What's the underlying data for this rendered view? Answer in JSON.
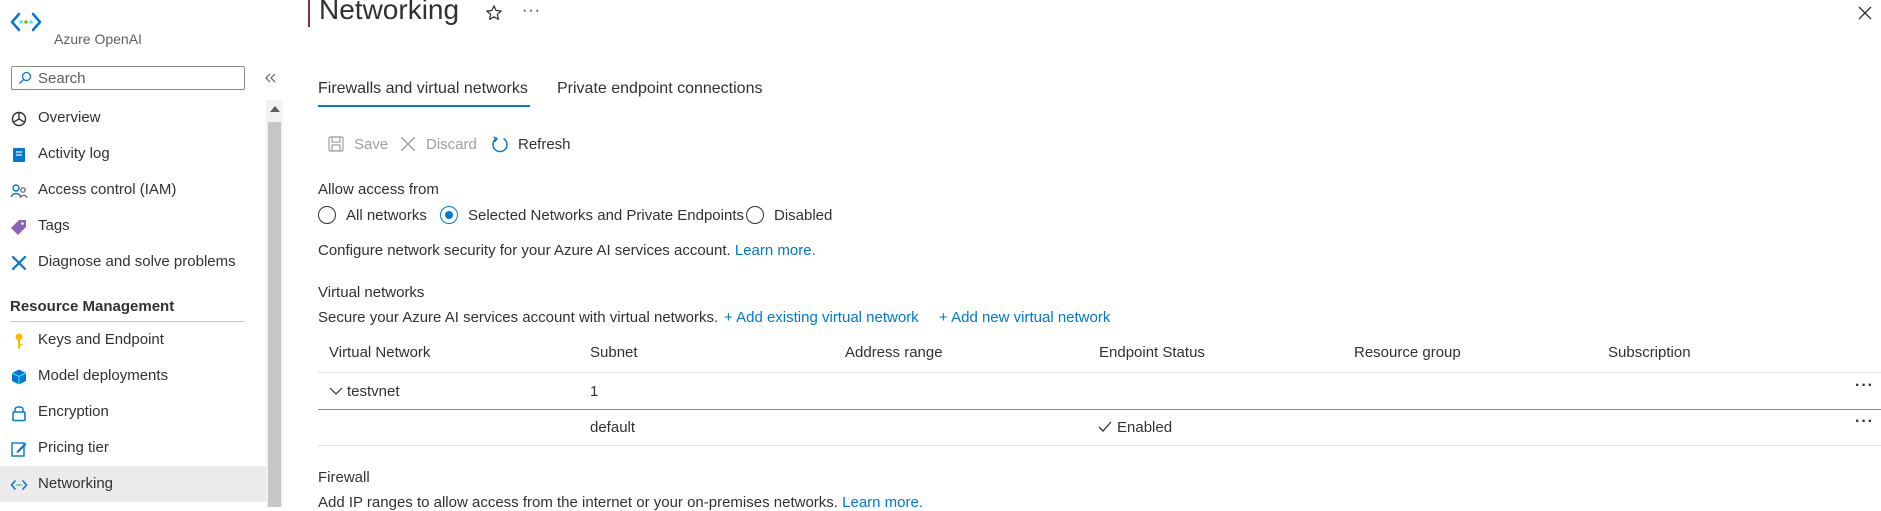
{
  "sidebar": {
    "brand_name": "Azure OpenAI",
    "search_placeholder": "Search",
    "items": [
      {
        "label": "Overview",
        "icon": "openai-icon"
      },
      {
        "label": "Activity log",
        "icon": "activity-log-icon"
      },
      {
        "label": "Access control (IAM)",
        "icon": "people-icon"
      },
      {
        "label": "Tags",
        "icon": "tag-icon"
      },
      {
        "label": "Diagnose and solve problems",
        "icon": "wrench-icon"
      }
    ],
    "section_title": "Resource Management",
    "section_items": [
      {
        "label": "Keys and Endpoint",
        "icon": "key-icon"
      },
      {
        "label": "Model deployments",
        "icon": "cube-icon"
      },
      {
        "label": "Encryption",
        "icon": "lock-icon"
      },
      {
        "label": "Pricing tier",
        "icon": "edit-icon"
      },
      {
        "label": "Networking",
        "icon": "networking-icon",
        "active": true
      }
    ]
  },
  "header": {
    "title": "Networking",
    "more": "···"
  },
  "tabs": [
    {
      "label": "Firewalls and virtual networks",
      "selected": true
    },
    {
      "label": "Private endpoint connections",
      "selected": false
    }
  ],
  "toolbar": {
    "save_label": "Save",
    "discard_label": "Discard",
    "refresh_label": "Refresh"
  },
  "access": {
    "heading": "Allow access from",
    "options": [
      "All networks",
      "Selected Networks and Private Endpoints",
      "Disabled"
    ],
    "selected_index": 1,
    "description": "Configure network security for your Azure AI services account.",
    "learn_more": "Learn more."
  },
  "virtual_networks": {
    "heading": "Virtual networks",
    "description": "Secure your Azure AI services account with virtual networks.",
    "add_existing": "+ Add existing virtual network",
    "add_new": "+ Add new virtual network",
    "columns": [
      "Virtual Network",
      "Subnet",
      "Address range",
      "Endpoint Status",
      "Resource group",
      "Subscription"
    ],
    "rows": [
      {
        "virtual_network": "testvnet",
        "subnet": "1",
        "address_range": "",
        "endpoint_status": "",
        "resource_group": "",
        "subscription": ""
      },
      {
        "virtual_network": "",
        "subnet": "default",
        "address_range": "",
        "endpoint_status": "Enabled",
        "resource_group": "",
        "subscription": ""
      }
    ],
    "row_more": "···"
  },
  "firewall": {
    "heading": "Firewall",
    "description": "Add IP ranges to allow access from the internet or your on-premises networks.",
    "learn_more": "Learn more."
  },
  "colors": {
    "accent": "#0078d4",
    "title_bar": "#8a2b5a",
    "active_nav_bg": "#edebe9"
  }
}
